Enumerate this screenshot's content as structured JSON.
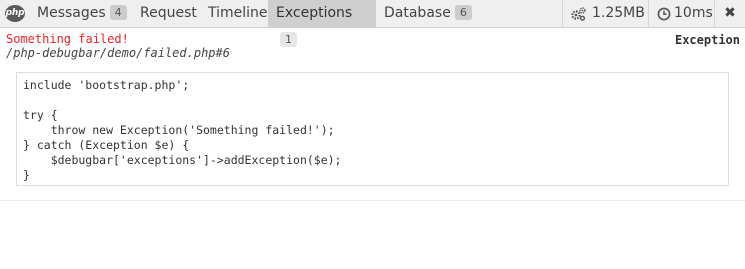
{
  "toolbar": {
    "logo_text": "php",
    "tabs": [
      {
        "label": "Messages",
        "badge": "4"
      },
      {
        "label": "Request"
      },
      {
        "label": "Timeline"
      },
      {
        "label": "Exceptions",
        "badge": "1",
        "active": true
      },
      {
        "label": "Database",
        "badge": "6"
      }
    ],
    "memory": "1.25MB",
    "time": "10ms",
    "close_label": "✖",
    "icons": {
      "memory": "gears-icon",
      "time": "clock-icon",
      "close": "close-icon"
    }
  },
  "exception": {
    "message": "Something failed!",
    "file": "/php-debugbar/demo/failed.php#6",
    "type": "Exception",
    "code": "include 'bootstrap.php';\n\ntry {\n    throw new Exception('Something failed!');\n} catch (Exception $e) {\n    $debugbar['exceptions']->addException($e);\n}"
  },
  "colors": {
    "header_bg": "#efefef",
    "active_tab_bg": "#cfcfcf",
    "error_text": "#e8262a"
  }
}
